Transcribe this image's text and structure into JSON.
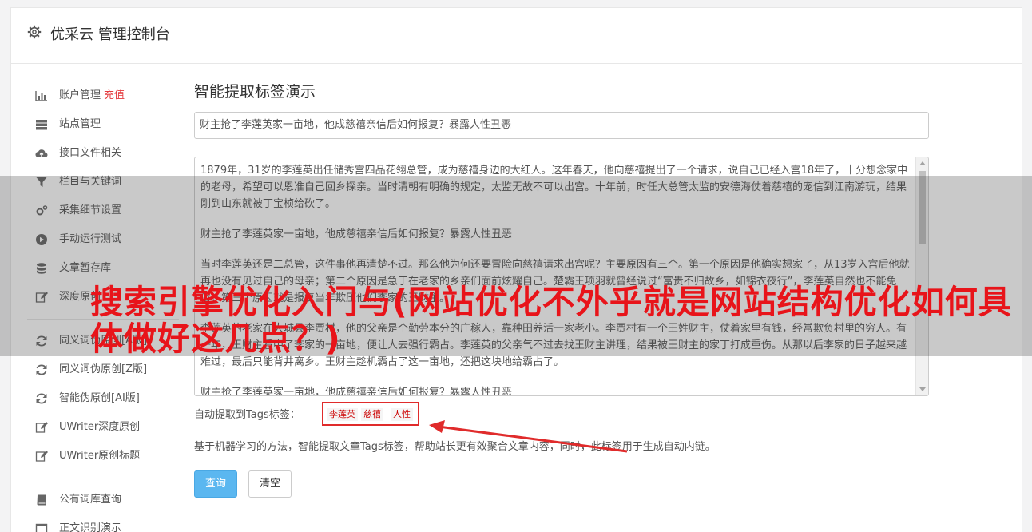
{
  "header": {
    "title": "优采云 管理控制台",
    "icon": "gear-icon"
  },
  "sidebar": {
    "items": [
      {
        "label": "账户管理",
        "extra": "充值",
        "icon": "bar-chart-icon"
      },
      {
        "label": "站点管理",
        "icon": "server-icon"
      },
      {
        "label": "接口文件相关",
        "icon": "cloud-upload-icon"
      },
      {
        "label": "栏目与关键词",
        "icon": "filter-icon"
      },
      {
        "label": "采集细节设置",
        "icon": "cogs-icon"
      },
      {
        "label": "手动运行测试",
        "icon": "play-circle-icon"
      },
      {
        "label": "文章暂存库",
        "icon": "database-icon"
      },
      {
        "label": "深度原创",
        "icon": "edit-icon"
      }
    ],
    "items2": [
      {
        "label": "同义词伪原创[A版]",
        "icon": "refresh-icon"
      },
      {
        "label": "同义词伪原创[Z版]",
        "icon": "refresh-icon"
      },
      {
        "label": "智能伪原创[AI版]",
        "icon": "refresh-icon"
      },
      {
        "label": "UWriter深度原创",
        "icon": "edit-icon"
      },
      {
        "label": "UWriter原创标题",
        "icon": "edit-icon"
      }
    ],
    "items3": [
      {
        "label": "公有词库查询",
        "icon": "book-icon"
      },
      {
        "label": "正文识别演示",
        "icon": "window-icon"
      }
    ]
  },
  "main": {
    "heading": "智能提取标签演示",
    "title_value": "财主抢了李莲英家一亩地，他成慈禧亲信后如何报复？暴露人性丑恶",
    "body_paragraphs": [
      "1879年，31岁的李莲英出任储秀宫四品花翎总管，成为慈禧身边的大红人。这年春天，他向慈禧提出了一个请求，说自己已经入宫18年了，十分想念家中的老母，希望可以恩准自己回乡探亲。当时清朝有明确的规定，太监无故不可以出宫。十年前，时任大总管太监的安德海仗着慈禧的宠信到江南游玩，结果刚到山东就被丁宝桢给砍了。",
      "财主抢了李莲英家一亩地，他成慈禧亲信后如何报复？暴露人性丑恶",
      "当时李莲英还是二总管，这件事他再清楚不过。那么他为何还要冒险向慈禧请求出宫呢？主要原因有三个。第一个原因是他确实想家了，从13岁入宫后他就再也没有见过自己的母亲；第二个原因是急于在老家的乡亲们面前炫耀自己。楚霸王项羽就曾经说过“富贵不归故乡，如锦衣夜行”，李莲英自然也不能免俗；第三个原因就是报复当年欺压他们李家的王财主。",
      "李莲英的老家在大城县李贾村，他的父亲是个勤劳本分的庄稼人，靠种田养活一家老小。李贾村有一个王姓财主，仗着家里有钱，经常欺负村里的穷人。有一年，王财主看中了李家的一亩地，便让人去强行霸占。李莲英的父亲气不过去找王财主讲理，结果被王财主的家丁打成重伤。从那以后李家的日子越来越难过，最后只能背井离乡。王财主趁机霸占了这一亩地，还把这块地给霸占了。",
      "财主抢了李莲英家一亩地，他成慈禧亲信后如何报复？暴露人性丑恶"
    ],
    "tags_label": "自动提取到Tags标签：",
    "tags": [
      "李莲英",
      "慈禧",
      "人性"
    ],
    "description": "基于机器学习的方法，智能提取文章Tags标签，帮助站长更有效聚合文章内容，同时，此标签用于生成自动内链。",
    "query_button": "查询",
    "clear_button": "清空"
  },
  "overlay": {
    "text": "搜索引擎优化入门与(网站优化不外乎就是网站结构优化如何具体做好这几点？)",
    "color": "#e8141a"
  }
}
